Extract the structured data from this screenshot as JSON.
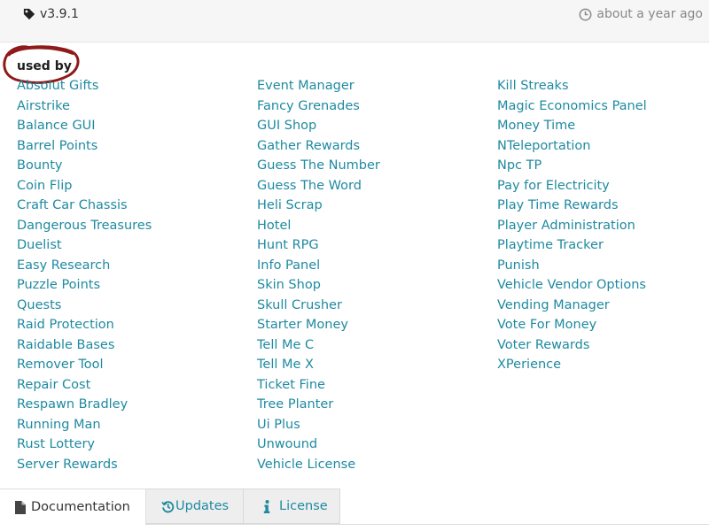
{
  "release": {
    "version": "v3.9.1",
    "timestamp": "about a year ago"
  },
  "used_by": {
    "title": "used by",
    "columns": [
      [
        "Absolut Gifts",
        "Airstrike",
        "Balance GUI",
        "Barrel Points",
        "Bounty",
        "Coin Flip",
        "Craft Car Chassis",
        "Dangerous Treasures",
        "Duelist",
        "Easy Research",
        "Puzzle Points",
        "Quests",
        "Raid Protection",
        "Raidable Bases",
        "Remover Tool",
        "Repair Cost",
        "Respawn Bradley",
        "Running Man",
        "Rust Lottery",
        "Server Rewards"
      ],
      [
        "Event Manager",
        "Fancy Grenades",
        "GUI Shop",
        "Gather Rewards",
        "Guess The Number",
        "Guess The Word",
        "Heli Scrap",
        "Hotel",
        "Hunt RPG",
        "Info Panel",
        "Skin Shop",
        "Skull Crusher",
        "Starter Money",
        "Tell Me C",
        "Tell Me X",
        "Ticket Fine",
        "Tree Planter",
        "Ui Plus",
        "Unwound",
        "Vehicle License"
      ],
      [
        "Kill Streaks",
        "Magic Economics Panel",
        "Money Time",
        "NTeleportation",
        "Npc TP",
        "Pay for Electricity",
        "Play Time Rewards",
        "Player Administration",
        "Playtime Tracker",
        "Punish",
        "Vehicle Vendor Options",
        "Vending Manager",
        "Vote For Money",
        "Voter Rewards",
        "XPerience"
      ]
    ]
  },
  "tabs": [
    {
      "label": "Documentation",
      "icon": "file-icon",
      "active": true
    },
    {
      "label": "Updates",
      "icon": "history-icon",
      "active": false
    },
    {
      "label": "License",
      "icon": "info-icon",
      "active": false
    }
  ],
  "colors": {
    "link": "#1f8aa0",
    "annotation": "#8e1a1a"
  }
}
